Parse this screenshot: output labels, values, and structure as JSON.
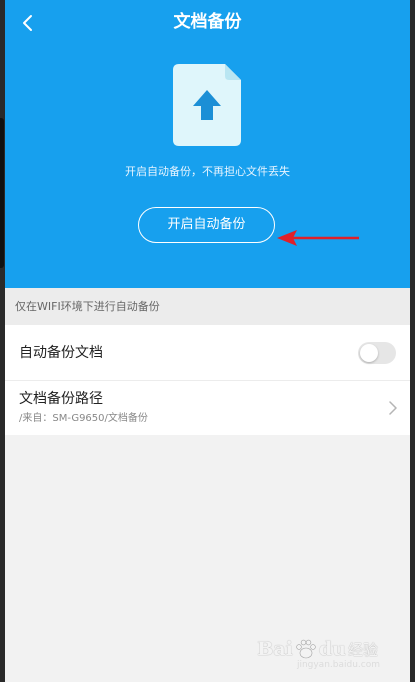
{
  "header": {
    "title": "文档备份",
    "subtitle": "开启自动备份，不再担心文件丢失",
    "cta_label": "开启自动备份",
    "back_icon": "chevron-left-icon",
    "doc_icon": "upload-document-icon",
    "background": "#17a0ee"
  },
  "settings": {
    "note": "仅在WIFI环境下进行自动备份",
    "items": [
      {
        "label": "自动备份文档",
        "toggle_on": false
      },
      {
        "label": "文档备份路径",
        "sub": "/来自：SM-G9650/文档备份",
        "icon": "chevron-right-icon"
      }
    ]
  },
  "annotation": {
    "arrow_color": "#e0202a"
  },
  "watermark": {
    "brand": "Bai",
    "brand_suffix": "du",
    "sub": "经验",
    "url": "jingyan.baidu.com"
  }
}
